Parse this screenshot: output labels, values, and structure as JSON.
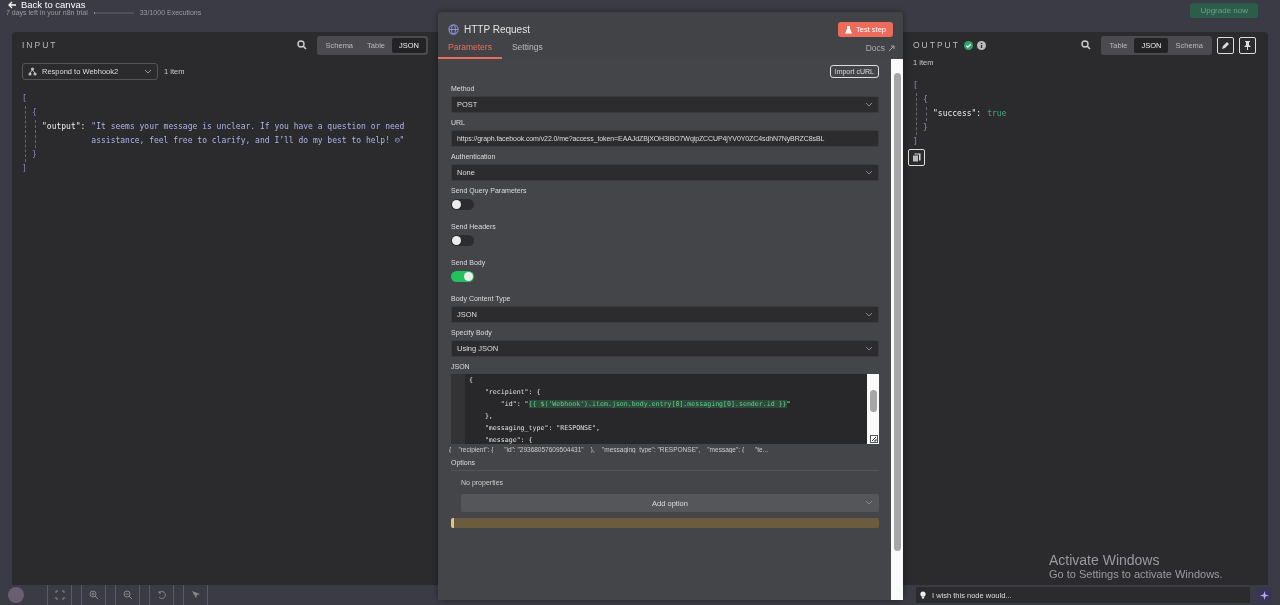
{
  "top_bar": {
    "back_label": "Back to canvas",
    "trial_text": "7 days left in your n8n trial",
    "executions": "33/1000 Executions",
    "executions_progress": {
      "level": 0.033
    },
    "upgrade_label": "Upgrade now"
  },
  "input_panel": {
    "title": "INPUT",
    "views": [
      {
        "label": "Schema",
        "selected": false
      },
      {
        "label": "Table",
        "selected": false
      },
      {
        "label": "JSON",
        "selected": true
      }
    ],
    "node_select": "Respond to Webhook2",
    "item_count": "1 item",
    "json": {
      "open": "[",
      "item_open": "{",
      "key": "\"output\":",
      "value": "\"It seems your message is unclear. If you have a question or need",
      "value_cont": "assistance, feel free to clarify, and I’ll do my best to help! ☺\"",
      "item_close": "}",
      "close": "]"
    }
  },
  "node_panel": {
    "title": "HTTP Request",
    "test_button": "Test step",
    "tabs": [
      {
        "label": "Parameters",
        "selected": true
      },
      {
        "label": "Settings",
        "selected": false
      }
    ],
    "docs": "Docs",
    "import_button": "Import cURL",
    "fields": [
      {
        "kind": "select",
        "label": "Method",
        "value": "POST"
      },
      {
        "kind": "text",
        "label": "URL",
        "value": "https://graph.facebook.com/v22.0/me?access_token=EAAJdZBjXOH3IBO7WqipZCCUP4jYV0Y0ZC4sdhN7NyBRZC8sBL"
      },
      {
        "kind": "select",
        "label": "Authentication",
        "value": "None"
      },
      {
        "kind": "toggle",
        "label": "Send Query Parameters",
        "on": false
      },
      {
        "kind": "toggle",
        "label": "Send Headers",
        "on": false
      },
      {
        "kind": "toggle",
        "label": "Send Body",
        "on": true
      },
      {
        "kind": "select",
        "label": "Body Content Type",
        "value": "JSON"
      },
      {
        "kind": "select",
        "label": "Specify Body",
        "value": "Using JSON"
      },
      {
        "kind": "code",
        "label": "JSON",
        "lines": [
          {
            "text": "{"
          },
          {
            "text": "    \"recipient\": {"
          },
          {
            "text": "        \"id\": \"",
            "expression": "{{ $('Webhook').item.json.body.entry[0].messaging[0].sender.id }}",
            "after": "\""
          },
          {
            "text": "    },"
          },
          {
            "text": "    \"messaging_type\": \"RESPONSE\","
          },
          {
            "text": "    \"message\": {"
          }
        ],
        "preview": "{    \"recipient\": {      \"id\": \"29368057609504431\"    },    \"messaging_type\": \"RESPONSE\",    \"message\": {      \"te..."
      }
    ],
    "options": {
      "label": "Options",
      "empty": "No properties",
      "add_label": "Add option"
    }
  },
  "output_panel": {
    "title": "OUTPUT",
    "views": [
      {
        "label": "Table",
        "selected": false
      },
      {
        "label": "JSON",
        "selected": true
      },
      {
        "label": "Schema",
        "selected": false
      }
    ],
    "item_count": "1 item",
    "json": {
      "open": "[",
      "item_open": "{",
      "key": "\"success\":",
      "value": "true",
      "item_close": "}",
      "close": "]"
    }
  },
  "feedback": "I wish this node would...",
  "os_notice": {
    "title": "Activate Windows",
    "subtitle": "Go to Settings to activate Windows."
  }
}
